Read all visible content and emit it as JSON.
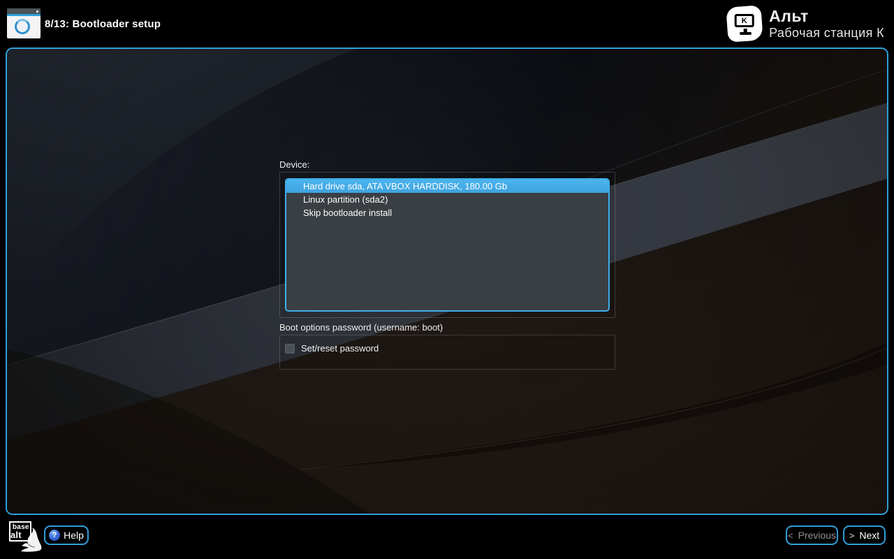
{
  "header": {
    "title": "8/13: Bootloader setup",
    "brand": {
      "name": "Альт",
      "edition": "Рабочая станция К",
      "icon_letter": "K"
    }
  },
  "form": {
    "device_label": "Device:",
    "device_list": {
      "items": [
        {
          "label": "Hard drive sda, ATA VBOX HARDDISK, 180.00 Gb",
          "selected": true
        },
        {
          "label": "Linux partition (sda2)",
          "selected": false
        },
        {
          "label": "Skip bootloader install",
          "selected": false
        }
      ]
    },
    "password_section_label": "Boot options password (username: boot)",
    "password_checkbox": {
      "label": "Set/reset password",
      "checked": false
    }
  },
  "footer": {
    "logo_line1": "base",
    "logo_line2": "alt",
    "help_icon": "?",
    "help_button": "Help",
    "previous_chevron": "<",
    "previous_button": "Previous",
    "next_chevron": ">",
    "next_button": "Next"
  },
  "colors": {
    "accent_border": "#2e9fd8",
    "selection_blue": "#3daee9",
    "listbox_background": "#3a3f44",
    "background": "#000000"
  }
}
